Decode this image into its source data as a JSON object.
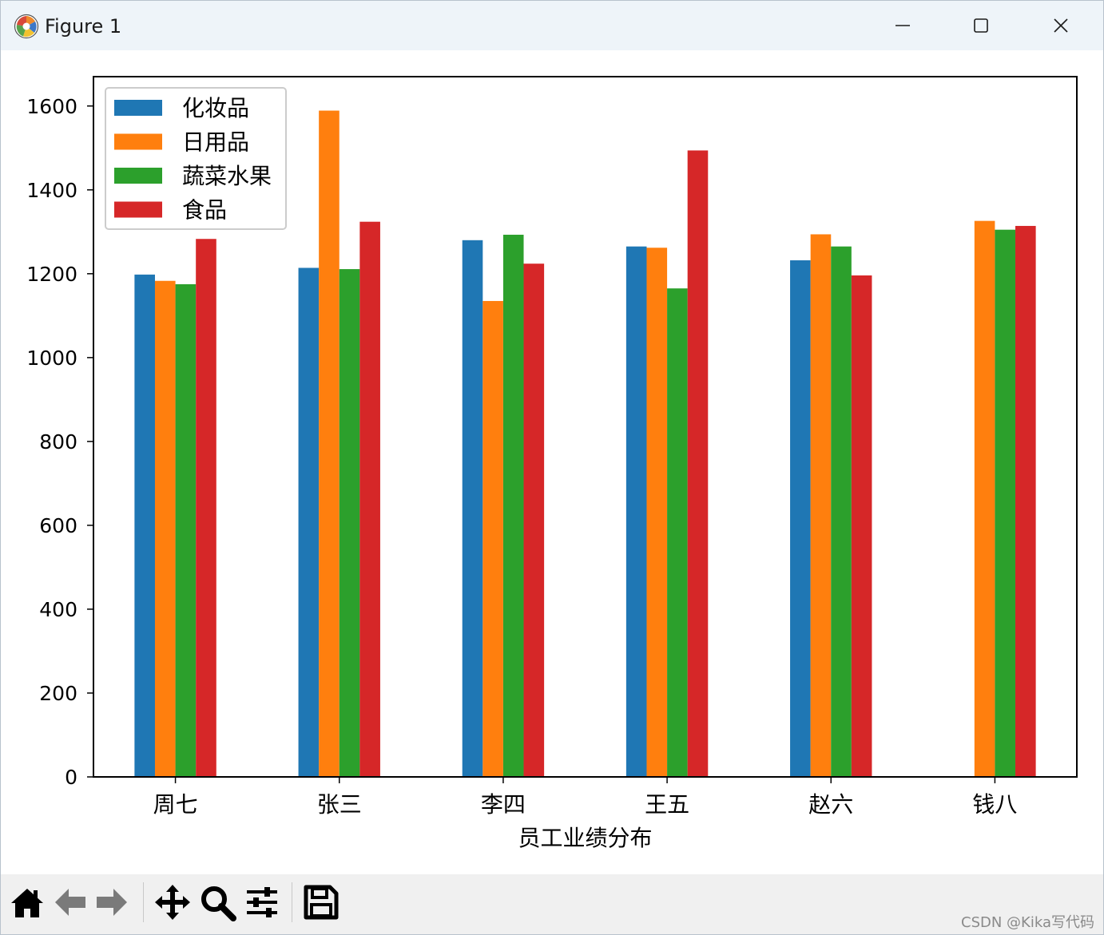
{
  "window": {
    "title": "Figure 1",
    "controls": {
      "minimize": "minimize-icon",
      "maximize": "maximize-icon",
      "close": "close-icon"
    }
  },
  "toolbar": {
    "tools": [
      "home-icon",
      "back-arrow-icon",
      "forward-arrow-icon",
      "pan-icon",
      "zoom-icon",
      "configure-subplots-icon",
      "save-icon"
    ]
  },
  "watermark": "CSDN @Kika写代码",
  "chart_data": {
    "type": "bar",
    "xlabel": "员工业绩分布",
    "ylabel": "",
    "ylim": [
      0,
      1670
    ],
    "yticks": [
      0,
      200,
      400,
      600,
      800,
      1000,
      1200,
      1400,
      1600
    ],
    "categories": [
      "周七",
      "张三",
      "李四",
      "王五",
      "赵六",
      "钱八"
    ],
    "series": [
      {
        "name": "化妆品",
        "color": "#1f77b4",
        "values": [
          1198,
          1214,
          1280,
          1265,
          1232,
          null
        ]
      },
      {
        "name": "日用品",
        "color": "#ff7f0e",
        "values": [
          1183,
          1589,
          1135,
          1262,
          1294,
          1326
        ]
      },
      {
        "name": "蔬菜水果",
        "color": "#2ca02c",
        "values": [
          1175,
          1211,
          1293,
          1165,
          1265,
          1305
        ]
      },
      {
        "name": "食品",
        "color": "#d62728",
        "values": [
          1283,
          1324,
          1224,
          1494,
          1196,
          1314
        ]
      }
    ],
    "legend": {
      "location": "upper-left"
    },
    "grid": false
  }
}
